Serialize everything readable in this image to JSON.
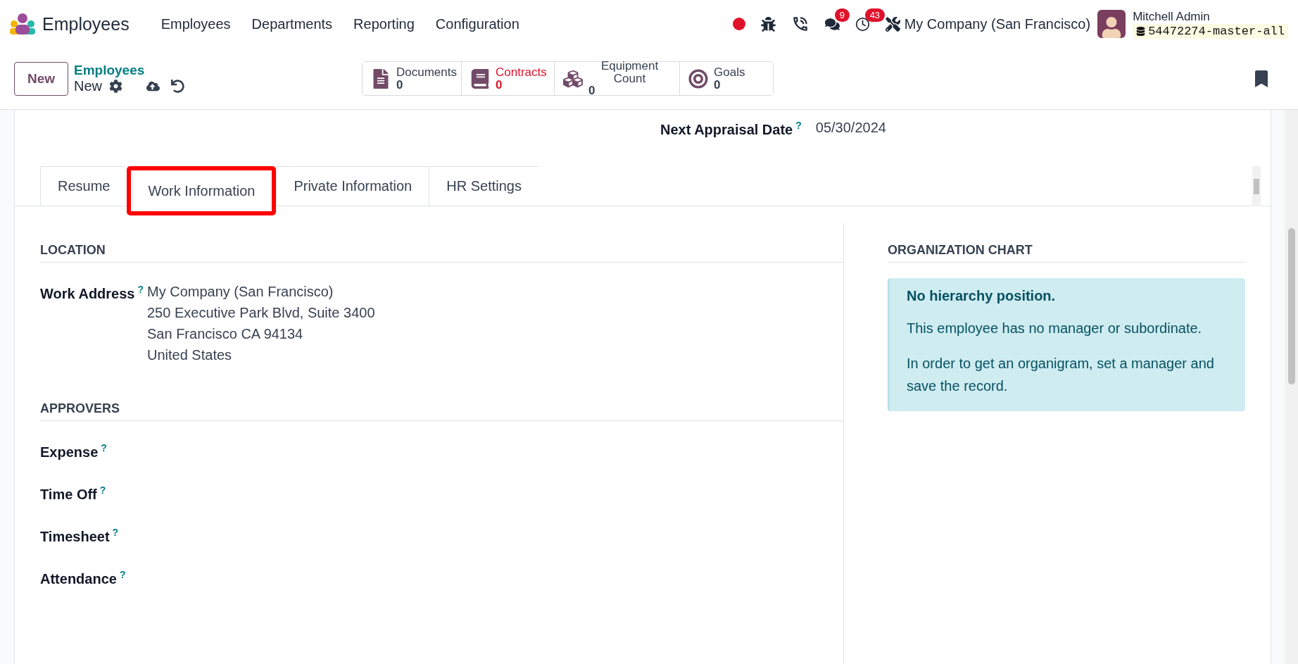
{
  "navbar": {
    "app_name": "Employees",
    "menu": [
      "Employees",
      "Departments",
      "Reporting",
      "Configuration"
    ],
    "messages_count": "9",
    "activities_count": "43",
    "company": "My Company (San Francisco)",
    "user_name": "Mitchell Admin",
    "database": "54472274-master-all"
  },
  "control_panel": {
    "new_button": "New",
    "breadcrumb": "Employees",
    "record": "New",
    "smart_buttons": [
      {
        "kind": "document",
        "label": "Documents",
        "value": "0",
        "color": "#374151"
      },
      {
        "kind": "book",
        "label": "Contracts",
        "value": "0",
        "color": "#e0112b"
      },
      {
        "kind": "cubes",
        "label": "Equipment Count",
        "value": "0",
        "color": "#374151"
      },
      {
        "kind": "target",
        "label": "Goals",
        "value": "0",
        "color": "#374151"
      }
    ]
  },
  "form": {
    "next_appraisal": {
      "label": "Next Appraisal Date",
      "help": "?",
      "value": "05/30/2024"
    },
    "tabs": [
      {
        "label": "Resume",
        "selected": false
      },
      {
        "label": "Work Information",
        "selected": true
      },
      {
        "label": "Private Information",
        "selected": false
      },
      {
        "label": "HR Settings",
        "selected": false
      }
    ],
    "location": {
      "heading": "LOCATION",
      "work_address": {
        "label": "Work Address",
        "help": "?",
        "lines": [
          "My Company (San Francisco)",
          "250 Executive Park Blvd, Suite 3400",
          "San Francisco CA 94134",
          "United States"
        ]
      }
    },
    "approvers": {
      "heading": "APPROVERS",
      "fields": [
        {
          "label": "Expense",
          "help": "?"
        },
        {
          "label": "Time Off",
          "help": "?"
        },
        {
          "label": "Timesheet",
          "help": "?"
        },
        {
          "label": "Attendance",
          "help": "?"
        }
      ]
    },
    "org_chart": {
      "heading": "ORGANIZATION CHART",
      "title": "No hierarchy position.",
      "paragraphs": [
        "This employee has no manager or subordinate.",
        "In order to get an organigram, set a manager and save the record."
      ]
    }
  }
}
